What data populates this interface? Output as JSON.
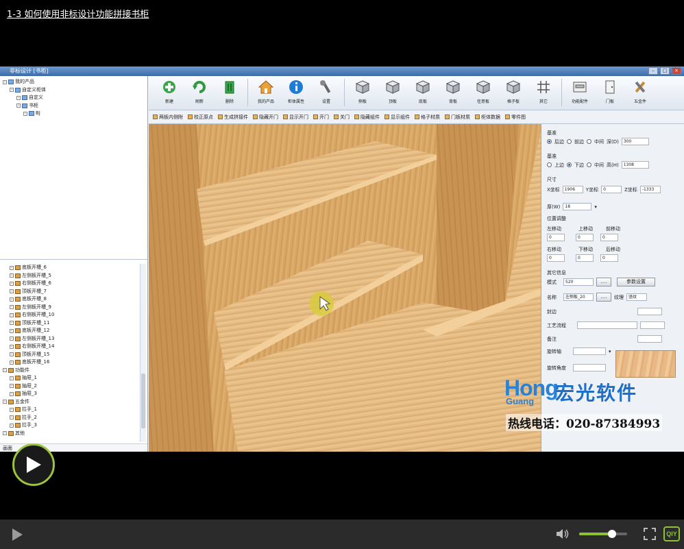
{
  "video": {
    "title": "1-3   如何使用非标设计功能拼接书柜",
    "volume_level": 0.68
  },
  "app": {
    "window_title": "非标设计 [书柜]",
    "toolbar": [
      {
        "label": "新建",
        "icon": "add-icon"
      },
      {
        "label": "刷新",
        "icon": "refresh-icon"
      },
      {
        "label": "删除",
        "icon": "trash-icon"
      },
      {
        "label": "我的产品",
        "icon": "home-icon"
      },
      {
        "label": "柜体属性",
        "icon": "info-icon"
      },
      {
        "label": "设置",
        "icon": "wrench-icon"
      },
      {
        "label": "侧板",
        "icon": "cube-icon"
      },
      {
        "label": "顶板",
        "icon": "cube-icon"
      },
      {
        "label": "底板",
        "icon": "cube-icon"
      },
      {
        "label": "背板",
        "icon": "cube-icon"
      },
      {
        "label": "任意板",
        "icon": "cube-icon"
      },
      {
        "label": "格子板",
        "icon": "cube-icon"
      },
      {
        "label": "其它",
        "icon": "grid-icon"
      },
      {
        "label": "功能配件",
        "icon": "drawer-icon"
      },
      {
        "label": "门板",
        "icon": "door-icon"
      },
      {
        "label": "五金件",
        "icon": "tools-icon"
      }
    ],
    "subbar": [
      "两板内侧附",
      "校正原点",
      "生成拼接件",
      "隐藏开门",
      "显示开门",
      "开门",
      "关门",
      "隐藏组件",
      "显示组件",
      "格子材质",
      "门板材质",
      "柜体数据",
      "零件图"
    ],
    "tree_top": [
      {
        "label": "我的产品",
        "indent": 0
      },
      {
        "label": "自定义柜体",
        "indent": 1
      },
      {
        "label": "自定义",
        "indent": 2
      },
      {
        "label": "书柜",
        "indent": 2
      },
      {
        "label": "BJ",
        "indent": 3
      }
    ],
    "tree_bottom": [
      {
        "label": "底板开槽_6",
        "indent": 1
      },
      {
        "label": "左侧板开槽_5",
        "indent": 1
      },
      {
        "label": "右侧板开槽_6",
        "indent": 1
      },
      {
        "label": "顶板开槽_7",
        "indent": 1
      },
      {
        "label": "底板开槽_8",
        "indent": 1
      },
      {
        "label": "左侧板开槽_9",
        "indent": 1
      },
      {
        "label": "右侧板开槽_10",
        "indent": 1
      },
      {
        "label": "顶板开槽_11",
        "indent": 1
      },
      {
        "label": "底板开槽_12",
        "indent": 1
      },
      {
        "label": "左侧板开槽_13",
        "indent": 1
      },
      {
        "label": "右侧板开槽_14",
        "indent": 1
      },
      {
        "label": "顶板开槽_15",
        "indent": 1
      },
      {
        "label": "底板开槽_16",
        "indent": 1
      },
      {
        "label": "功能件",
        "indent": 0
      },
      {
        "label": "抽屉_1",
        "indent": 1
      },
      {
        "label": "抽屉_2",
        "indent": 1
      },
      {
        "label": "抽屉_3",
        "indent": 1
      },
      {
        "label": "五金件",
        "indent": 0
      },
      {
        "label": "拉手_1",
        "indent": 1
      },
      {
        "label": "拉手_2",
        "indent": 1
      },
      {
        "label": "拉手_3",
        "indent": 1
      },
      {
        "label": "其他",
        "indent": 0
      }
    ],
    "tree_status": "画面",
    "props": {
      "group1": "基准",
      "g1_opts": [
        "后边",
        "前边",
        "中间"
      ],
      "g1_field_label": "深(D)",
      "g1_field_value": "300",
      "group2": "基准",
      "g2_opts": [
        "上边",
        "下边",
        "中间"
      ],
      "g2_field_label": "高(H)",
      "g2_field_value": "1308",
      "size_title": "尺寸",
      "x_label": "X坐标",
      "x_value": "1906",
      "y_label": "Y坐标",
      "y_value": "0",
      "z_label": "Z坐标",
      "z_value": "-1333",
      "thick_label": "厚(W)",
      "thick_value": "18",
      "pos_title": "位置调整",
      "left_move": "左移动",
      "up_move": "上移动",
      "front_move": "前移动",
      "right_move": "右移动",
      "down_move": "下移动",
      "back_move": "后移动",
      "zero": "0",
      "other_title": "其它信息",
      "model_label": "模式",
      "model_value": "520",
      "param_btn": "参数设置",
      "name_label": "名称",
      "name_value": "左侧板_20",
      "texture_label": "纹理",
      "texture_value": "竖纹",
      "edge_label": "封边",
      "process_label": "工艺流程",
      "note_label": "备注",
      "rot_axis_label": "旋转轴",
      "rot_angle_label": "旋转角度",
      "ellipsis": "...."
    }
  },
  "watermark": {
    "logo_line1": "Hong",
    "logo_line2": "Guang",
    "company_cn": "宏光软件",
    "hotline": "热线电话：020-87384993"
  },
  "player": {
    "qiyi_logo": "QIY"
  }
}
